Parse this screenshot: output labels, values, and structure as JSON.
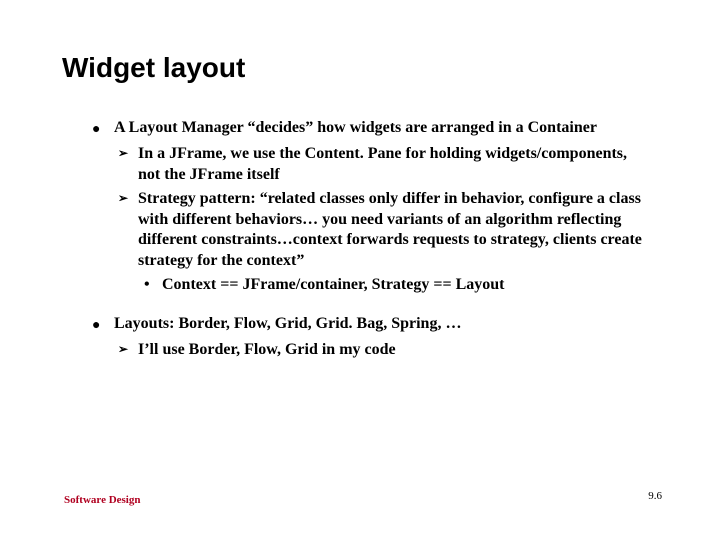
{
  "title": "Widget layout",
  "bullets": {
    "b1": "A Layout Manager “decides” how widgets are arranged in a Container",
    "b1_sub1": "In a JFrame, we use the Content. Pane for holding widgets/components, not the JFrame itself",
    "b1_sub2": "Strategy pattern: “related classes only differ in behavior, configure a class with different behaviors… you need variants of an algorithm reflecting different constraints…context forwards requests to strategy, clients create strategy for the context”",
    "b1_sub2_a": "Context == JFrame/container, Strategy == Layout",
    "b2": "Layouts: Border, Flow, Grid, Grid. Bag, Spring, …",
    "b2_sub1": "I’ll use Border, Flow, Grid in my code"
  },
  "footer": {
    "left": "Software Design",
    "right": "9.6"
  },
  "glyphs": {
    "disc": "●",
    "arrow": "➢",
    "dot": "•"
  }
}
